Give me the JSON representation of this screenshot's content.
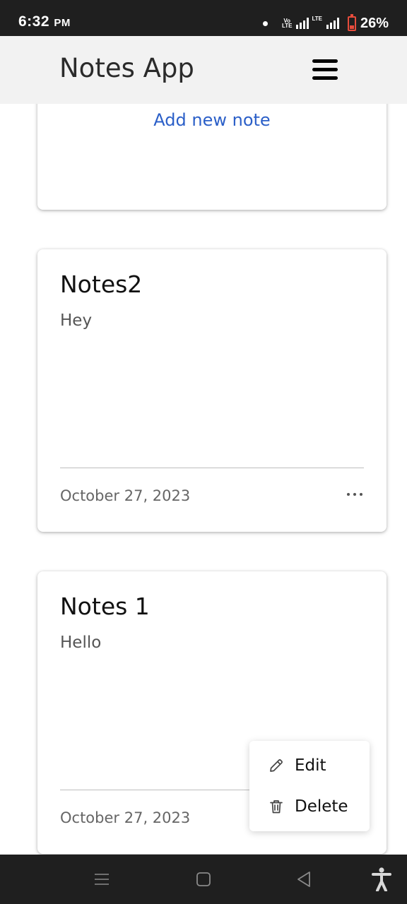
{
  "status_bar": {
    "time": "6:32",
    "ampm": "PM",
    "volte_top": "Vo",
    "volte_bottom": "LTE",
    "lte": "LTE",
    "battery": "26%"
  },
  "app_bar": {
    "title": "Notes App",
    "menu_icon": "hamburger-icon"
  },
  "add_card": {
    "label": "Add new note"
  },
  "notes": [
    {
      "title": "Notes2",
      "body": "Hey",
      "date": "October 27, 2023"
    },
    {
      "title": "Notes 1",
      "body": "Hello",
      "date": "October 27, 2023"
    }
  ],
  "context_menu": {
    "items": [
      {
        "label": "Edit",
        "icon": "pencil-icon"
      },
      {
        "label": "Delete",
        "icon": "trash-icon"
      }
    ]
  },
  "nav_bar": {
    "icons": [
      "recent-apps-icon",
      "home-icon",
      "back-icon",
      "accessibility-icon"
    ]
  },
  "colors": {
    "accent": "#2b5fc8",
    "status_bar_bg": "#1f1f1f",
    "app_bar_bg": "#f2f2f2",
    "battery": "#e74c3c"
  }
}
